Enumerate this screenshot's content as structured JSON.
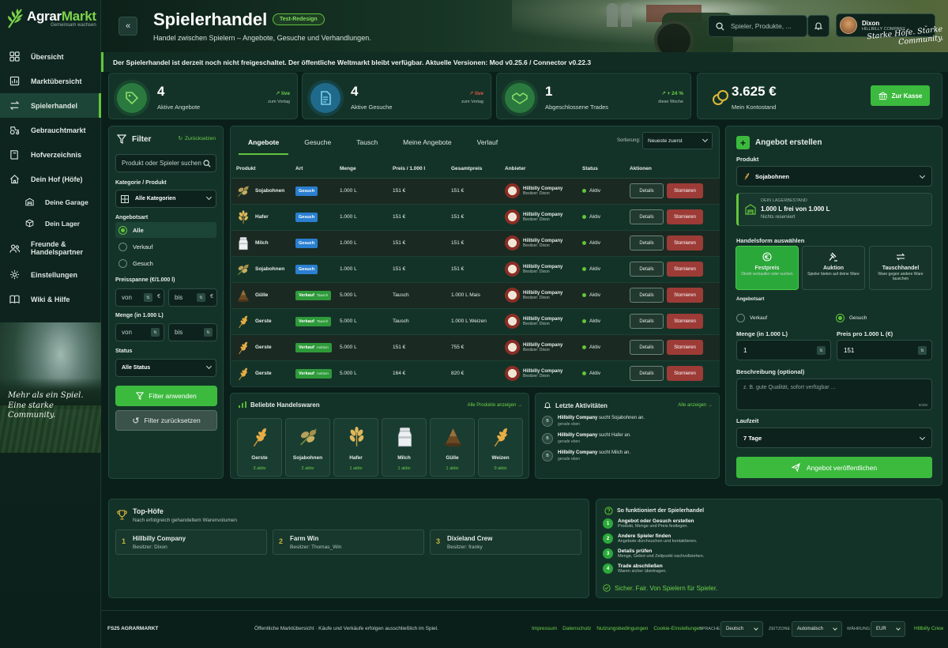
{
  "brand": {
    "title_a": "Agrar",
    "title_b": "Markt",
    "subtitle": "Gemeinsam wachsen"
  },
  "nav": [
    {
      "label": "Übersicht",
      "icon": "grid-icon"
    },
    {
      "label": "Marktübersicht",
      "icon": "chart-icon"
    },
    {
      "label": "Spielerhandel",
      "icon": "swap-icon",
      "active": true
    },
    {
      "label": "Gebrauchtmarkt",
      "icon": "tractor-icon"
    },
    {
      "label": "Hofverzeichnis",
      "icon": "book-icon"
    },
    {
      "label": "Dein Hof (Höfe)",
      "icon": "house-icon"
    },
    {
      "label": "Deine Garage",
      "icon": "garage-icon",
      "sub": true
    },
    {
      "label": "Dein Lager",
      "icon": "box-icon",
      "sub": true
    },
    {
      "label": "Freunde &\nHandelspartner",
      "icon": "people-icon"
    },
    {
      "label": "Einstellungen",
      "icon": "gear-icon"
    },
    {
      "label": "Wiki & Hilfe",
      "icon": "open-book-icon"
    }
  ],
  "side_quote": "Mehr als ein Spiel. Eine starke Community.",
  "header": {
    "title": "Spielerhandel",
    "badge": "Test-Redesign",
    "subtitle": "Handel zwischen Spielern – Angebote, Gesuche und Verhandlungen.",
    "search_placeholder": "Spieler, Produkte, ...",
    "user_name": "Dixon",
    "user_company": "HILLBILLY COMPANY",
    "slogan": "Starke Höfe. Starke Community."
  },
  "notice": "Der Spielerhandel ist derzeit noch nicht freigeschaltet. Der öffentliche Weltmarkt bleibt verfügbar. Aktuelle Versionen: Mod v0.25.6 / Connector v0.22.3",
  "stats": [
    {
      "value": "4",
      "label": "Aktive Angebote",
      "trend": "↗ live",
      "trend_sub": "zum Vortag",
      "color": "#2a7a3f"
    },
    {
      "value": "4",
      "label": "Aktive Gesuche",
      "trend": "↗ live",
      "trend_sub": "zum Vortag",
      "color": "#1f6a8a"
    },
    {
      "value": "1",
      "label": "Abgeschlossene Trades",
      "trend": "↗ + 24 %",
      "trend_sub": "diese Woche",
      "color": "#2a7a3f"
    },
    {
      "value": "3.625 €",
      "label": "Mein Kontostand",
      "button": "Zur Kasse",
      "color": "#b8942a"
    }
  ],
  "filter": {
    "title": "Filter",
    "reset_link": "Zurücksetzen",
    "search_placeholder": "Produkt oder Spieler suchen",
    "category_label": "Kategorie / Produkt",
    "category_value": "Alle Kategorien",
    "type_label": "Angebotsart",
    "types": [
      "Alle",
      "Verkauf",
      "Gesuch"
    ],
    "price_label": "Preisspanne (€/1.000 l)",
    "qty_label": "Menge (in 1.000 L)",
    "from": "von",
    "to": "bis",
    "currency": "€",
    "status_label": "Status",
    "status_value": "Alle Status",
    "apply": "Filter anwenden",
    "reset": "Filter zurücksetzen"
  },
  "tabs": [
    "Angebote",
    "Gesuche",
    "Tausch",
    "Meine Angebote",
    "Verlauf"
  ],
  "sort": {
    "label": "Sortierung:",
    "value": "Neueste zuerst"
  },
  "table": {
    "headers": [
      "Produkt",
      "Art",
      "Menge",
      "Preis / 1.000 l",
      "Gesamtpreis",
      "Anbieter",
      "Status",
      "Aktionen"
    ],
    "rows": [
      {
        "product": "Sojabohnen",
        "icon": "soybean-icon",
        "type": "Gesuch",
        "type_sub": "",
        "qty": "1.000 L",
        "price": "151 €",
        "total": "151 €",
        "provider": "Hillbilly Company",
        "owner": "Besitzer: Dixon",
        "status": "Aktiv"
      },
      {
        "product": "Hafer",
        "icon": "oat-icon",
        "type": "Gesuch",
        "type_sub": "",
        "qty": "1.000 L",
        "price": "151 €",
        "total": "151 €",
        "provider": "Hillbilly Company",
        "owner": "Besitzer: Dixon",
        "status": "Aktiv"
      },
      {
        "product": "Milch",
        "icon": "milk-icon",
        "type": "Gesuch",
        "type_sub": "",
        "qty": "1.000 L",
        "price": "151 €",
        "total": "151 €",
        "provider": "Hillbilly Company",
        "owner": "Besitzer: Dixon",
        "status": "Aktiv"
      },
      {
        "product": "Sojabohnen",
        "icon": "soybean-icon",
        "type": "Gesuch",
        "type_sub": "",
        "qty": "1.000 L",
        "price": "151 €",
        "total": "151 €",
        "provider": "Hillbilly Company",
        "owner": "Besitzer: Dixon",
        "status": "Aktiv"
      },
      {
        "product": "Gülle",
        "icon": "slurry-icon",
        "type": "Verkauf",
        "type_sub": "Tausch",
        "qty": "5.000 L",
        "price": "Tausch",
        "total": "1.000 L Mais",
        "provider": "Hillbilly Company",
        "owner": "Besitzer: Dixon",
        "status": "Aktiv"
      },
      {
        "product": "Gerste",
        "icon": "wheat-icon",
        "type": "Verkauf",
        "type_sub": "Tausch",
        "qty": "5.000 L",
        "price": "Tausch",
        "total": "1.000 L Weizen",
        "provider": "Hillbilly Company",
        "owner": "Besitzer: Dixon",
        "status": "Aktiv"
      },
      {
        "product": "Gerste",
        "icon": "wheat-icon",
        "type": "Verkauf",
        "type_sub": "Auktion",
        "qty": "5.000 L",
        "price": "151 €",
        "total": "755 €",
        "provider": "Hillbilly Company",
        "owner": "Besitzer: Dixon",
        "status": "Aktiv"
      },
      {
        "product": "Gerste",
        "icon": "wheat-icon",
        "type": "Verkauf",
        "type_sub": "Auktion",
        "qty": "5.000 L",
        "price": "164 €",
        "total": "820 €",
        "provider": "Hillbilly Company",
        "owner": "Besitzer: Dixon",
        "status": "Aktiv"
      }
    ],
    "btn_details": "Details",
    "btn_cancel": "Stornieren"
  },
  "popular": {
    "title": "Beliebte Handelswaren",
    "link": "Alle Produkte anzeigen",
    "items": [
      {
        "name": "Gerste",
        "count": "3 aktiv",
        "icon": "wheat-icon"
      },
      {
        "name": "Sojabohnen",
        "count": "2 aktiv",
        "icon": "soybean-icon"
      },
      {
        "name": "Hafer",
        "count": "1 aktiv",
        "icon": "oat-icon"
      },
      {
        "name": "Milch",
        "count": "1 aktiv",
        "icon": "milk-icon"
      },
      {
        "name": "Gülle",
        "count": "1 aktiv",
        "icon": "slurry-icon"
      },
      {
        "name": "Weizen",
        "count": "0 aktiv",
        "icon": "wheat-icon"
      }
    ]
  },
  "activity": {
    "title": "Letzte Aktivitäten",
    "link": "Alle anzeigen",
    "items": [
      {
        "who": "Hillbilly Company",
        "text": "sucht Sojabohnen an.",
        "time": "gerade eben"
      },
      {
        "who": "Hillbilly Company",
        "text": "sucht Hafer an.",
        "time": "gerade eben"
      },
      {
        "who": "Hillbilly Company",
        "text": "sucht Milch an.",
        "time": "gerade eben"
      }
    ]
  },
  "create": {
    "title": "Angebot erstellen",
    "product_label": "Produkt",
    "product_value": "Sojabohnen",
    "stock_caption": "DEIN LAGERBESTAND",
    "stock_value": "1.000 L frei von 1.000 L",
    "stock_sub": "Nichts reserviert",
    "mode_label": "Handelsform auswählen",
    "modes": [
      {
        "name": "Festpreis",
        "desc": "Direkt verkaufen oder suchen",
        "icon": "euro-icon"
      },
      {
        "name": "Auktion",
        "desc": "Spieler bieten auf deine Ware",
        "icon": "gavel-icon"
      },
      {
        "name": "Tauschhandel",
        "desc": "Ware gegen andere Ware tauschen",
        "icon": "exchange-icon"
      }
    ],
    "type_label": "Angebotsart",
    "type_sell": "Verkauf",
    "type_want": "Gesuch",
    "qty_label": "Menge (in 1.000 L)",
    "qty_value": "1",
    "price_label": "Preis pro 1.000 L (€)",
    "price_value": "151",
    "desc_label": "Beschreibung (optional)",
    "desc_placeholder": "z. B. gute Qualität, sofort verfügbar ...",
    "desc_counter": "0/200",
    "duration_label": "Laufzeit",
    "duration_value": "7 Tage",
    "publish": "Angebot veröffentlichen"
  },
  "top_farms": {
    "title": "Top-Höfe",
    "subtitle": "Nach erfolgreich gehandeltem Warenvolumen",
    "items": [
      {
        "rank": "1",
        "name": "Hillbilly Company",
        "owner": "Besitzer: Dixon"
      },
      {
        "rank": "2",
        "name": "Farm Win",
        "owner": "Besitzer: Thomas_Win"
      },
      {
        "rank": "3",
        "name": "Dixieland Crew",
        "owner": "Besitzer: franky"
      }
    ]
  },
  "howto": {
    "title": "So funktioniert der Spielerhandel",
    "steps": [
      {
        "n": "1",
        "title": "Angebot oder Gesuch erstellen",
        "desc": "Produkt, Menge und Preis festlegen."
      },
      {
        "n": "2",
        "title": "Andere Spieler finden",
        "desc": "Angebote durchsuchen und kontaktieren."
      },
      {
        "n": "3",
        "title": "Details prüfen",
        "desc": "Menge, Gebot und Zeitpunkt nachvollziehen."
      },
      {
        "n": "4",
        "title": "Trade abschließen",
        "desc": "Waren sicher übertragen."
      }
    ],
    "footer": "Sicher. Fair. Von Spielern für Spieler."
  },
  "footer": {
    "brand": "FS25 AGRARMARKT",
    "desc": "Öffentliche Marktübersicht · Käufe und Verkäufe erfolgen ausschließlich im Spiel.",
    "links": [
      "Impressum",
      "Datenschutz",
      "Nutzungsbedingungen",
      "Cookie-Einstellungen"
    ],
    "lang_label": "SPRACHE",
    "lang_value": "Deutsch",
    "tz_label": "ZEITZONE",
    "tz_value": "Automatisch",
    "cur_label": "WÄHRUNG",
    "cur_value": "EUR",
    "company": "Hillbilly Crew"
  }
}
